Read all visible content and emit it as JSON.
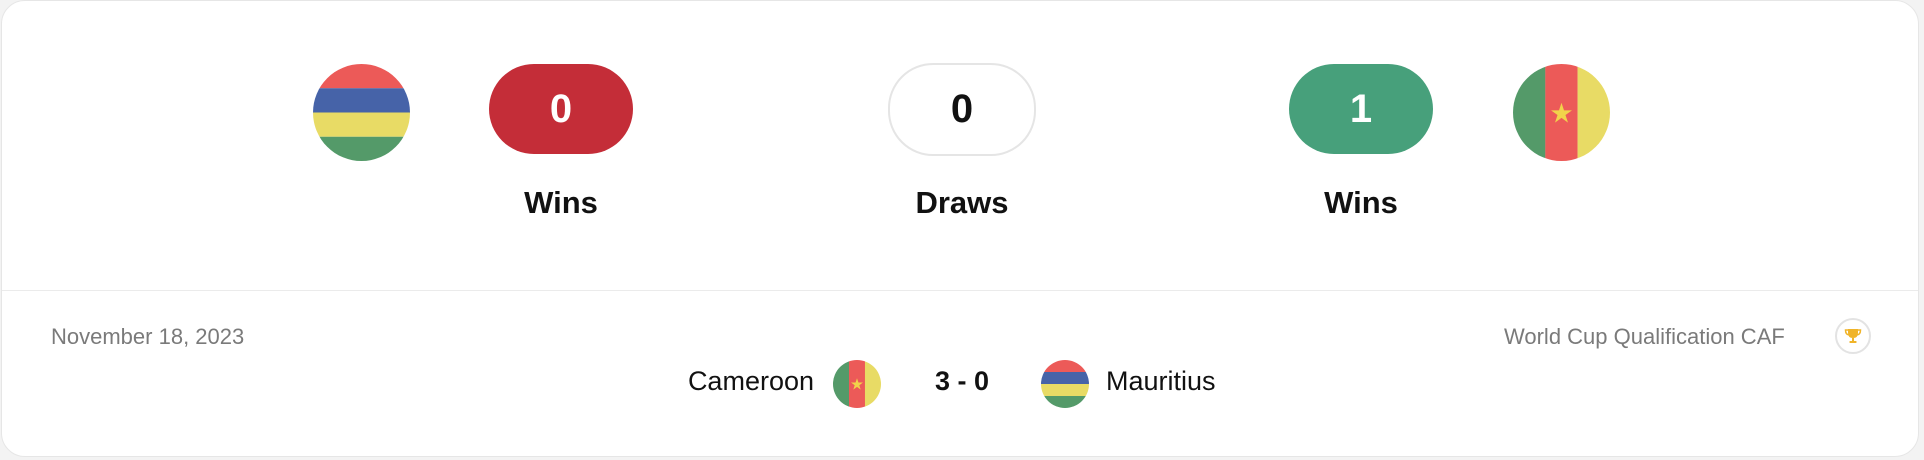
{
  "head_to_head": {
    "left_team": {
      "name": "Mauritius",
      "flag_icon": "mauritius-flag-icon",
      "wins": "0",
      "wins_label": "Wins"
    },
    "draws": {
      "count": "0",
      "label": "Draws"
    },
    "right_team": {
      "name": "Cameroon",
      "flag_icon": "cameroon-flag-icon",
      "wins": "1",
      "wins_label": "Wins"
    }
  },
  "last_match": {
    "date": "November 18, 2023",
    "competition": "World Cup Qualification CAF",
    "competition_icon": "trophy-icon",
    "home_team": "Cameroon",
    "away_team": "Mauritius",
    "score": "3 - 0"
  },
  "colors": {
    "loss": "#c42d38",
    "win": "#47a07b",
    "draw_border": "#e5e5e5",
    "muted_text": "#7a7a7a",
    "trophy": "#f0b429"
  }
}
